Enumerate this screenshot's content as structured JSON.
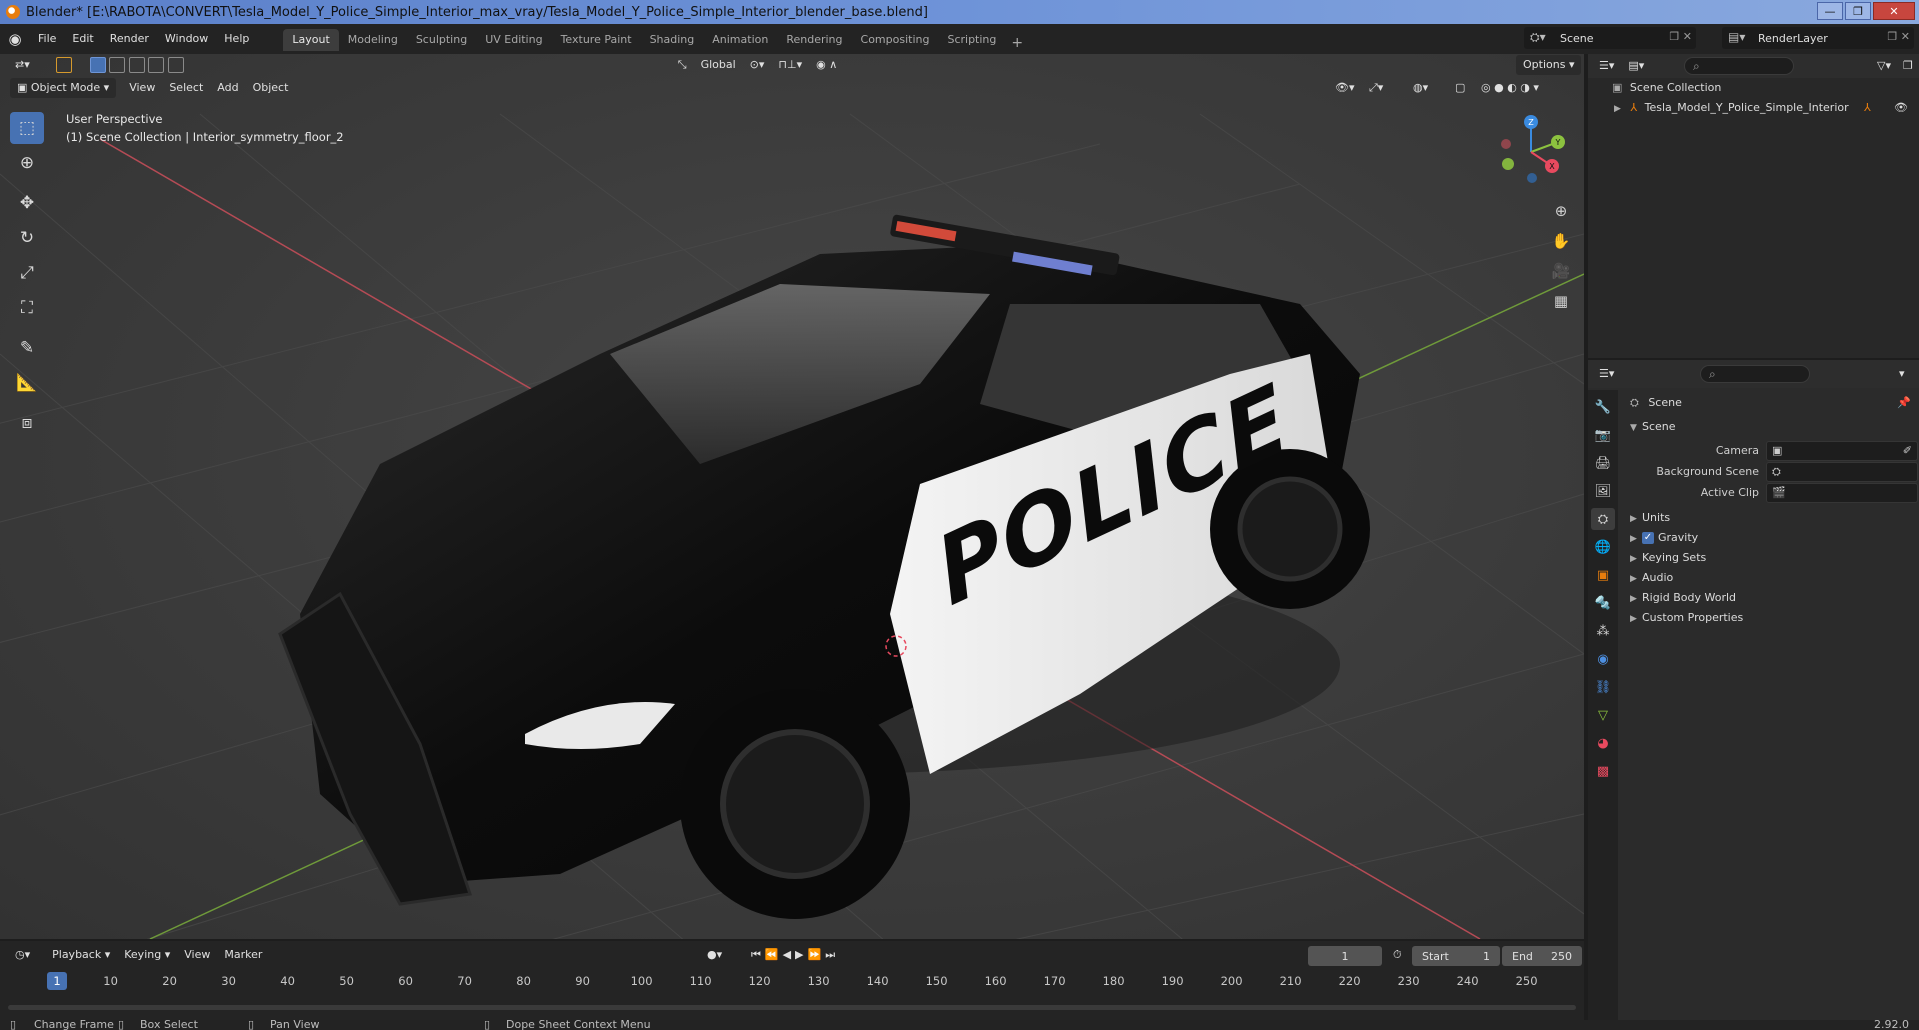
{
  "window": {
    "title": "Blender* [E:\\RABOTA\\CONVERT\\Tesla_Model_Y_Police_Simple_Interior_max_vray/Tesla_Model_Y_Police_Simple_Interior_blender_base.blend]",
    "minimize": "—",
    "maximize": "❐",
    "close": "✕"
  },
  "menu": {
    "items": [
      "File",
      "Edit",
      "Render",
      "Window",
      "Help"
    ]
  },
  "workspaces": {
    "tabs": [
      "Layout",
      "Modeling",
      "Sculpting",
      "UV Editing",
      "Texture Paint",
      "Shading",
      "Animation",
      "Rendering",
      "Compositing",
      "Scripting"
    ],
    "active": "Layout",
    "add": "+"
  },
  "scene_selector": {
    "value": "Scene"
  },
  "view_layer_selector": {
    "value": "RenderLayer"
  },
  "viewport": {
    "mode": "Object Mode",
    "menus": [
      "View",
      "Select",
      "Add",
      "Object"
    ],
    "transform_orientation": "Global",
    "options_label": "Options",
    "overlay_line1": "User Perspective",
    "overlay_line2": "(1) Scene Collection | Interior_symmetry_floor_2",
    "decal_text": "POLICE",
    "gizmo_axes": {
      "x": "X",
      "y": "Y",
      "z": "Z"
    }
  },
  "outliner": {
    "search_placeholder": "⌕",
    "root": "Scene Collection",
    "items": [
      {
        "label": "Tesla_Model_Y_Police_Simple_Interior"
      }
    ]
  },
  "properties": {
    "search_placeholder": "⌕",
    "context_title": "Scene",
    "panel_title": "Scene",
    "fields": [
      {
        "label": "Camera"
      },
      {
        "label": "Background Scene"
      },
      {
        "label": "Active Clip"
      }
    ],
    "sections": [
      "Units",
      "Gravity",
      "Keying Sets",
      "Audio",
      "Rigid Body World",
      "Custom Properties"
    ],
    "gravity_checked": true
  },
  "timeline": {
    "menus": [
      "Playback",
      "Keying",
      "View",
      "Marker"
    ],
    "current_frame": "1",
    "start_label": "Start",
    "start_value": "1",
    "end_label": "End",
    "end_value": "250",
    "ruler_ticks": [
      "1",
      "10",
      "20",
      "30",
      "40",
      "50",
      "60",
      "70",
      "80",
      "90",
      "100",
      "110",
      "120",
      "130",
      "140",
      "150",
      "160",
      "170",
      "180",
      "190",
      "200",
      "210",
      "220",
      "230",
      "240",
      "250"
    ]
  },
  "statusbar": {
    "change_frame": "Change Frame",
    "box_select": "Box Select",
    "pan_view": "Pan View",
    "context_menu": "Dope Sheet Context Menu",
    "version": "2.92.0"
  },
  "colors": {
    "accent": "#4772b3",
    "axis_x": "#e84a5f",
    "axis_y": "#8cc23f",
    "axis_z": "#3a8be0",
    "object_orange": "#e87d0d"
  }
}
